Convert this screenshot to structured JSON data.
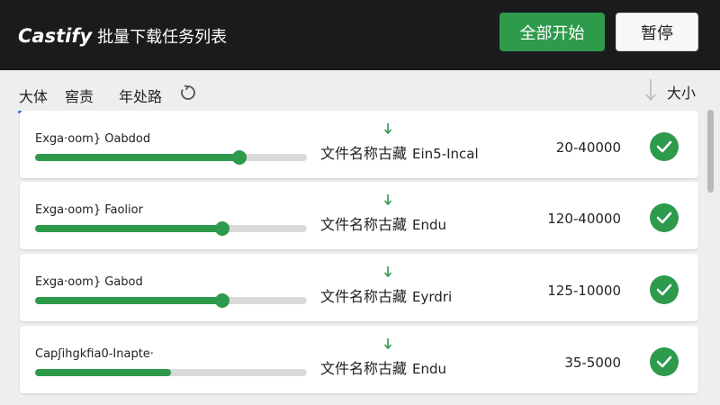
{
  "header": {
    "brand": "Castify",
    "subtitle": "批量下载任务列表",
    "start_all_label": "全部开始",
    "pause_label": "暂停"
  },
  "tabs": [
    {
      "label": "大体",
      "active": true
    },
    {
      "label": "窖责",
      "active": false
    },
    {
      "label": "年处路",
      "active": false
    }
  ],
  "toolbar": {
    "refresh_icon": "refresh-icon",
    "sort_icon": "sort-down-icon",
    "size_column_label": "大小"
  },
  "tasks": [
    {
      "name": "Exga·oom} Oabdod",
      "progress": 0.75,
      "label_cn": "文件名称古藏",
      "label_suffix": "Ein5-Incal",
      "size": "20-40000",
      "status_icon": "check-icon"
    },
    {
      "name": "Exga·oom} Faolior",
      "progress": 0.69,
      "label_cn": "文件名称古藏",
      "label_suffix": "Endu",
      "size": "120-40000",
      "status_icon": "check-icon"
    },
    {
      "name": "Exga·oom} Gabod",
      "progress": 0.69,
      "label_cn": "文件名称古藏",
      "label_suffix": "Eyrdri",
      "size": "125-10000",
      "status_icon": "check-icon"
    },
    {
      "name": "Capʃihgkfia0-Inapte·",
      "progress": 0.5,
      "label_cn": "文件名称古藏",
      "label_suffix": "Endu",
      "size": "35-5000",
      "status_icon": "check-icon"
    }
  ],
  "colors": {
    "header_bg": "#1b1b1d",
    "accent_green": "#2e9a4c",
    "tab_underline": "#2f6fc4",
    "card_bg": "#ffffff",
    "page_bg": "#eeeeef"
  }
}
